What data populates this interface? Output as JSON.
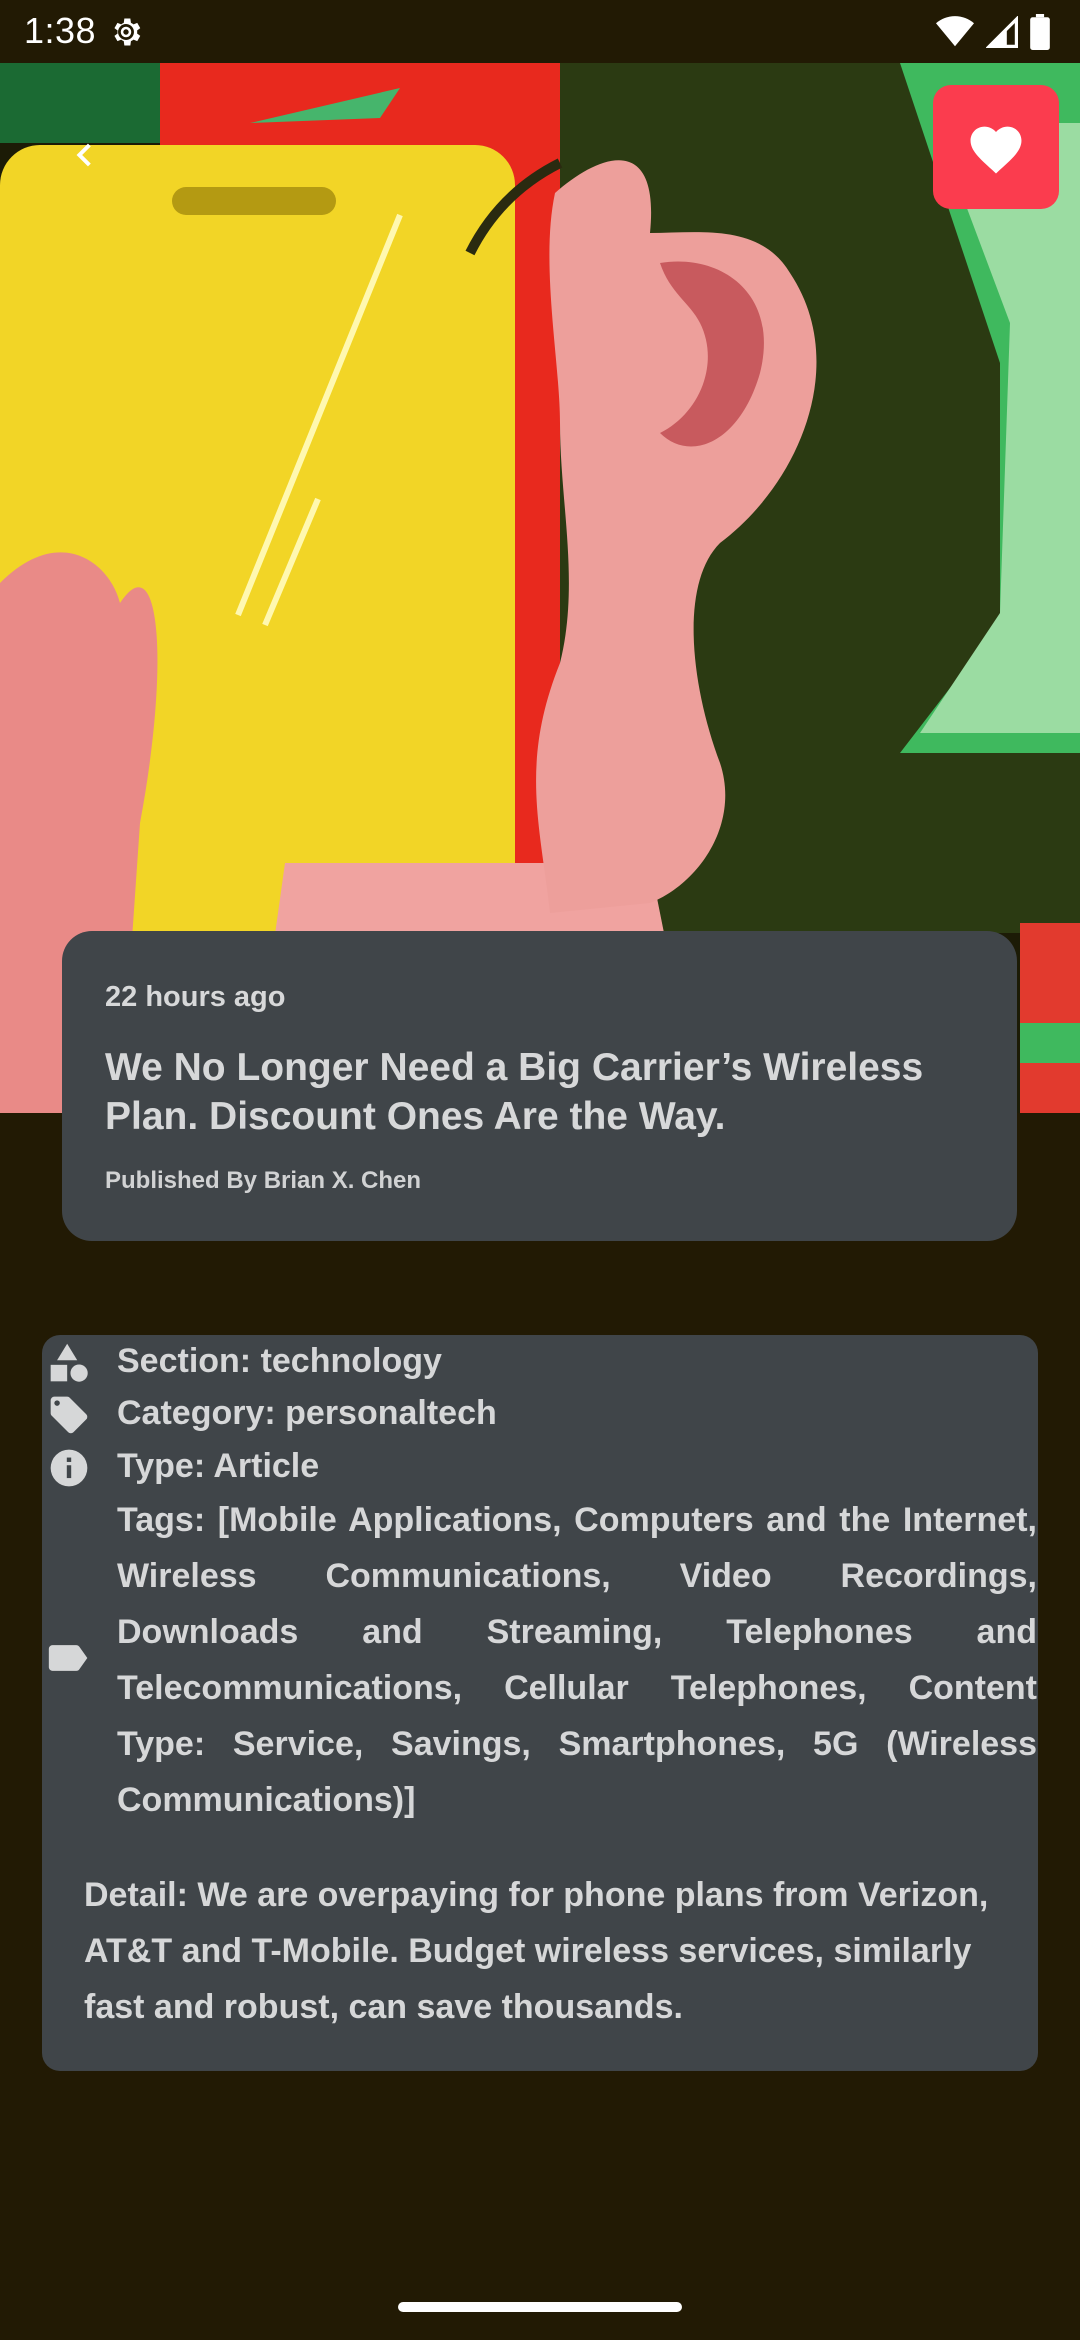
{
  "status_bar": {
    "time": "1:38",
    "icons": [
      "gear-icon",
      "wifi-icon",
      "signal-icon",
      "battery-icon"
    ]
  },
  "header": {
    "back_icon": "chevron-left-icon",
    "favorite_icon": "heart-icon",
    "favorite_color": "#fb3c4e"
  },
  "article": {
    "time_ago": "22 hours ago",
    "title": "We No Longer Need a Big Carrier’s Wireless Plan. Discount Ones Are the Way.",
    "byline": "Published By Brian X. Chen"
  },
  "details": {
    "section": "Section: technology",
    "category": "Category: personaltech",
    "type": "Type: Article",
    "tags": "Tags: [Mobile Applications, Computers and the Internet, Wireless Communications, Video Recordings, Downloads and Streaming, Telephones and Telecommunications, Cellular Telephones, Content Type: Service, Savings, Smartphones, 5G (Wireless Communications)]",
    "detail": "Detail: We are overpaying for phone plans from Verizon, AT&T and T-Mobile. Budget wireless services, similarly fast and robust, can save thousands."
  },
  "colors": {
    "background": "#221a04",
    "card": "#404549",
    "text": "#d7d8d9"
  }
}
